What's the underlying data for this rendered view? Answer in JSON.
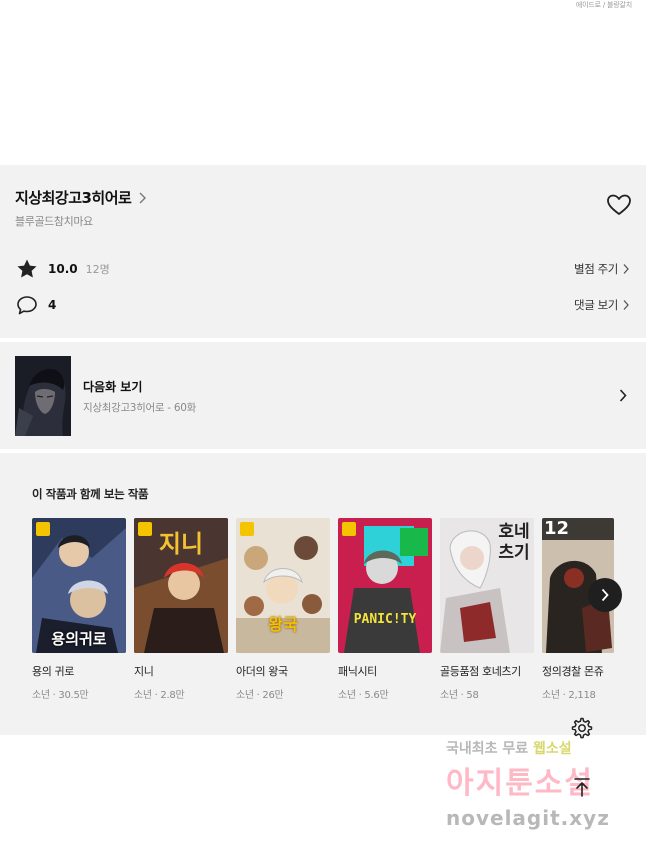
{
  "top": {
    "credit": "에이드로 / 블랑갈치"
  },
  "work": {
    "title": "지상최강고3히어로",
    "author": "블루골드참치마요",
    "rating": "10.0",
    "rating_count": "12명",
    "rate_link": "별점 주기",
    "comment_count": "4",
    "comment_link": "댓글 보기"
  },
  "next_episode": {
    "label": "다음화 보기",
    "sub": "지상최강고3히어로 - 60화"
  },
  "recommend": {
    "title": "이 작품과 함께 보는 작품",
    "items": [
      {
        "name": "용의 귀로",
        "meta": "소년 · 30.5만",
        "cover_text": "용의귀로",
        "bg": "#2f3b5c",
        "badge": true
      },
      {
        "name": "지니",
        "meta": "소년 · 2.8만",
        "cover_text": "지니",
        "bg": "#3a2a26",
        "badge": true
      },
      {
        "name": "아더의 왕국",
        "meta": "소년 · 26만",
        "cover_text": "왕국",
        "bg": "#e9e2d4",
        "badge": true
      },
      {
        "name": "패닉시티",
        "meta": "소년 · 5.6만",
        "cover_text": "PANIC!TY",
        "bg": "#c81f4e",
        "badge": true
      },
      {
        "name": "골등품점 호네츠기",
        "meta": "소년 · 58",
        "cover_text": "호네츠기",
        "bg": "#d9d6d6",
        "badge": false
      },
      {
        "name": "정의경찰 몬쥬",
        "meta": "소년 · 2,118",
        "cover_text": "12",
        "bg": "#b9a996",
        "badge": false
      }
    ]
  },
  "watermark": {
    "line1_prefix": "국내최초 무료 ",
    "line1_highlight": "웹소설",
    "line2": "아지툰소설",
    "line3": "novelagit.xyz"
  },
  "colors": {
    "card_bg": "#f2f2f2",
    "badge": "#f5c400",
    "text": "#222222",
    "muted": "#8a8a8a"
  }
}
